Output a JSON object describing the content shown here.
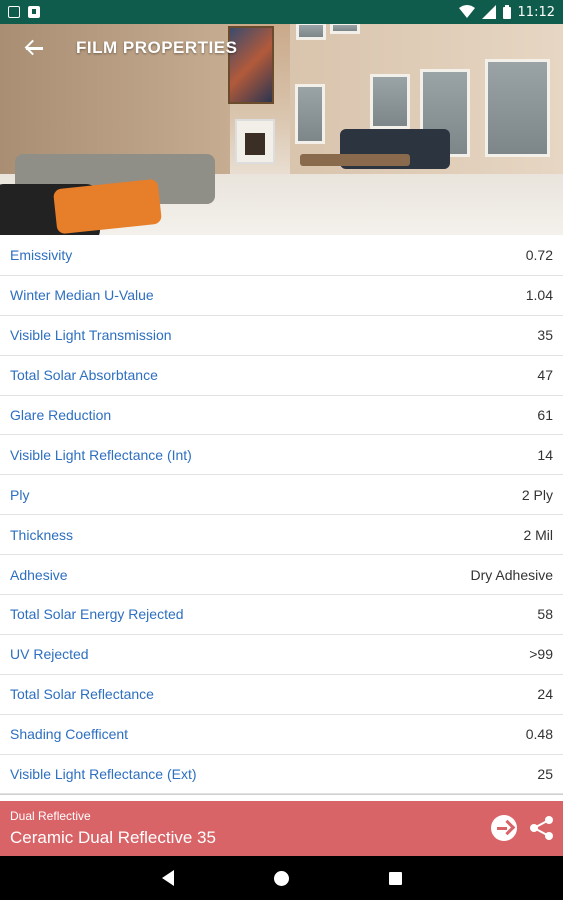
{
  "status_bar": {
    "time": "11:12",
    "icons": [
      "photo-icon",
      "app-icon",
      "wifi-icon",
      "signal-icon",
      "battery-icon"
    ]
  },
  "toolbar": {
    "title": "FILM PROPERTIES",
    "back_icon": "back-arrow-icon"
  },
  "properties": [
    {
      "label": "Emissivity",
      "value": "0.72"
    },
    {
      "label": "Winter Median U-Value",
      "value": "1.04"
    },
    {
      "label": "Visible Light Transmission",
      "value": "35"
    },
    {
      "label": "Total Solar Absorbtance",
      "value": "47"
    },
    {
      "label": "Glare Reduction",
      "value": "61"
    },
    {
      "label": "Visible Light Reflectance (Int)",
      "value": "14"
    },
    {
      "label": "Ply",
      "value": "2 Ply"
    },
    {
      "label": "Thickness",
      "value": "2 Mil"
    },
    {
      "label": "Adhesive",
      "value": "Dry Adhesive"
    },
    {
      "label": "Total Solar Energy Rejected",
      "value": "58"
    },
    {
      "label": "UV Rejected",
      "value": ">99"
    },
    {
      "label": "Total Solar Reflectance",
      "value": "24"
    },
    {
      "label": "Shading Coefficent",
      "value": "0.48"
    },
    {
      "label": "Visible Light Reflectance (Ext)",
      "value": "25"
    }
  ],
  "product_bar": {
    "category": "Dual Reflective",
    "name": "Ceramic Dual Reflective 35",
    "go_icon": "arrow-right-circle-icon",
    "share_icon": "share-icon"
  },
  "colors": {
    "status_bar": "#0f5c4c",
    "label_text": "#2d6fc0",
    "product_bar": "#d96468"
  }
}
